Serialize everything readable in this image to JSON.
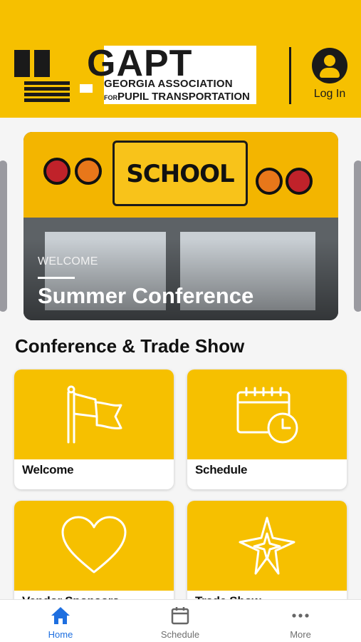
{
  "header": {
    "logo_text": "GAPT",
    "logo_line1": "GEORGIA ASSOCIATION",
    "logo_line2_small": "FOR",
    "logo_line2": "PUPIL TRANSPORTATION",
    "login_label": "Log In"
  },
  "carousel": {
    "image_text": "SCHOOL BUS",
    "kicker": "WELCOME",
    "title": "Summer Conference"
  },
  "section": {
    "title": "Conference & Trade Show"
  },
  "tiles": [
    {
      "label": "Welcome",
      "icon": "flag-icon"
    },
    {
      "label": "Schedule",
      "icon": "calendar-clock-icon"
    },
    {
      "label": "Vendor Sponsors",
      "icon": "heart-icon"
    },
    {
      "label": "Trade Show",
      "icon": "star-burst-icon"
    }
  ],
  "tabbar": {
    "items": [
      {
        "label": "Home",
        "icon": "home-icon",
        "active": true
      },
      {
        "label": "Schedule",
        "icon": "calendar-icon",
        "active": false
      },
      {
        "label": "More",
        "icon": "more-icon",
        "active": false
      }
    ]
  },
  "colors": {
    "brand_yellow": "#f6c000",
    "active_blue": "#1e6fe0",
    "text_dark": "#111111"
  }
}
